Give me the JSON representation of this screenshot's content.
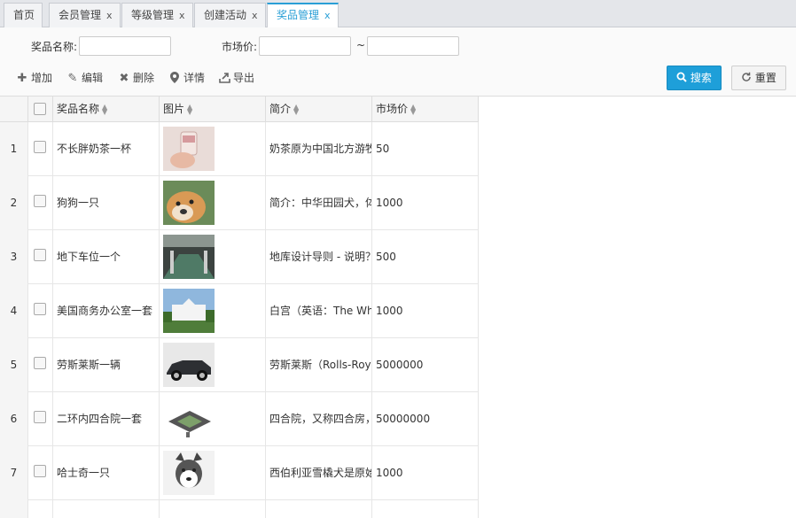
{
  "tabs": [
    {
      "label": "首页",
      "closable": false
    },
    {
      "label": "会员管理",
      "closable": true
    },
    {
      "label": "等级管理",
      "closable": true
    },
    {
      "label": "创建活动",
      "closable": true
    },
    {
      "label": "奖品管理",
      "closable": true,
      "active": true
    }
  ],
  "close_glyph": "x",
  "search": {
    "name_label": "奖品名称:",
    "price_label": "市场价:",
    "range_sep": "~",
    "name_value": "",
    "price_min": "",
    "price_max": ""
  },
  "toolbar": {
    "add": "增加",
    "edit": "编辑",
    "delete": "删除",
    "detail": "详情",
    "export": "导出",
    "search_btn": "搜索",
    "reset_btn": "重置"
  },
  "icons": {
    "add": "plus-icon",
    "edit": "pencil-icon",
    "delete": "x-icon",
    "detail": "map-marker-icon",
    "export": "export-icon",
    "search": "search-icon",
    "reset": "refresh-icon"
  },
  "colors": {
    "accent": "#1e9fd9",
    "active_tab": "#2a9fd6"
  },
  "grid": {
    "columns": [
      "奖品名称",
      "图片",
      "简介",
      "市场价"
    ],
    "rows": [
      {
        "no": "1",
        "name": "不长胖奶茶一杯",
        "image": "milk-tea-photo",
        "desc": "奶茶原为中国北方游牧",
        "price": "50"
      },
      {
        "no": "2",
        "name": "狗狗一只",
        "image": "shiba-dog-photo",
        "desc": "简介：中华田园犬，体",
        "price": "1000"
      },
      {
        "no": "3",
        "name": "地下车位一个",
        "image": "parking-garage-photo",
        "desc": "地库设计导则 - 说明？",
        "price": "500"
      },
      {
        "no": "4",
        "name": "美国商务办公室一套",
        "image": "white-house-photo",
        "desc": "白宫（英语：The Wh",
        "price": "1000"
      },
      {
        "no": "5",
        "name": "劳斯莱斯一辆",
        "image": "rolls-royce-photo",
        "desc": "劳斯莱斯（Rolls-Roy",
        "price": "5000000"
      },
      {
        "no": "6",
        "name": "二环内四合院一套",
        "image": "courtyard-house-photo",
        "desc": "四合院，又称四合房，",
        "price": "50000000"
      },
      {
        "no": "7",
        "name": "哈士奇一只",
        "image": "husky-photo",
        "desc": "西伯利亚雪橇犬是原始",
        "price": "1000"
      }
    ]
  }
}
